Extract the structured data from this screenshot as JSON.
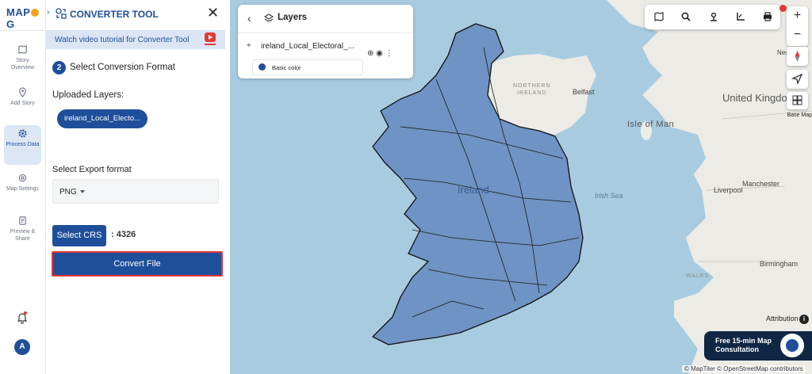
{
  "app": {
    "logo_text": "MAPOG"
  },
  "rail": {
    "items": [
      {
        "label": "Story Overview",
        "icon": "book-map-icon"
      },
      {
        "label": "Add Story",
        "icon": "pin-icon"
      },
      {
        "label": "Process Data",
        "icon": "gear-icon",
        "active": true
      },
      {
        "label": "Map Settings",
        "icon": "settings-icon"
      },
      {
        "label": "Preview & Share",
        "icon": "share-icon"
      }
    ],
    "avatar_initial": "A"
  },
  "panel": {
    "title": "CONVERTER TOOL",
    "close_label": "✕",
    "tutorial_text": "Watch video tutorial for Converter Tool",
    "step_number": "2",
    "step_label": "Select Conversion Format",
    "uploaded_label": "Uploaded Layers:",
    "uploaded_layer": "ireland_Local_Electo...",
    "export_label": "Select Export format",
    "export_value": "PNG",
    "crs_button": "Select CRS",
    "crs_value": ": 4326",
    "convert_button": "Convert File"
  },
  "layers_card": {
    "title": "Layers",
    "layer_name": "ireland_Local_Electoral_...",
    "style_label": "Basic color",
    "style_color": "#1f4f9a"
  },
  "map": {
    "labels": {
      "northern_ireland": "NORTHERN\nIRELAND",
      "belfast": "Belfast",
      "isle_of_man": "Isle of Man",
      "ireland": "Ireland",
      "irish_sea": "Irish Sea",
      "united_kingdom": "United Kingdom",
      "manchester": "Manchester",
      "liverpool": "Liverpool",
      "birmingham": "Birmingham",
      "wales": "WALES",
      "newcastle": "Newc..."
    },
    "basemap_label": "Base Map",
    "attribution_label": "Attribution",
    "consult_text": "Free 15-min Map Consultation",
    "copyright": "© MapTiler © OpenStreetMap contributors",
    "colors": {
      "sea": "#a8cbe0",
      "land": "#ecebe6",
      "layer_fill": "#6e93c4"
    }
  }
}
